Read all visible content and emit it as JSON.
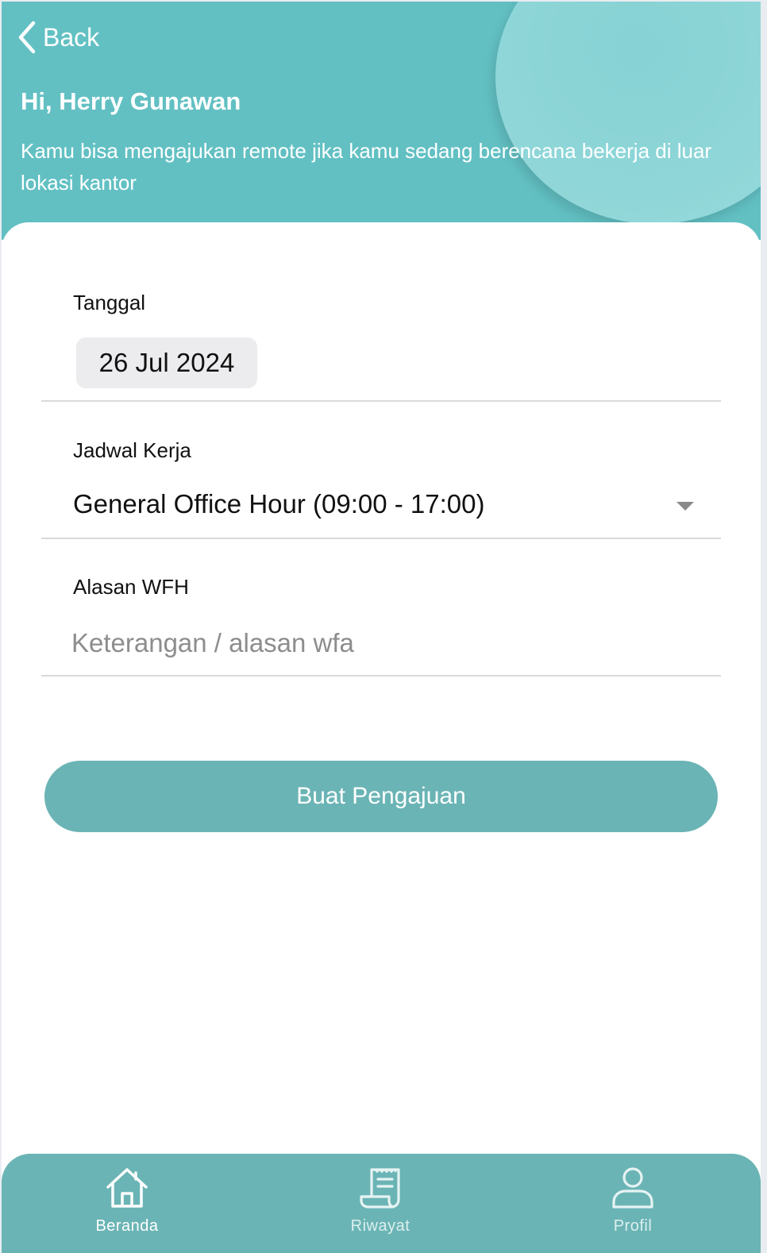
{
  "header": {
    "back_label": "Back",
    "greeting": "Hi, Herry Gunawan",
    "subtitle": "Kamu bisa mengajukan remote jika kamu sedang berencana bekerja di luar lokasi kantor"
  },
  "form": {
    "date": {
      "label": "Tanggal",
      "value": "26 Jul 2024"
    },
    "schedule": {
      "label": "Jadwal Kerja",
      "value": "General Office Hour (09:00 - 17:00)"
    },
    "reason": {
      "label": "Alasan WFH",
      "value": "",
      "placeholder": "Keterangan / alasan wfa"
    },
    "submit_label": "Buat Pengajuan"
  },
  "tabbar": {
    "items": [
      {
        "label": "Beranda",
        "icon": "home-icon",
        "active": true
      },
      {
        "label": "Riwayat",
        "icon": "receipt-icon",
        "active": false
      },
      {
        "label": "Profil",
        "icon": "user-icon",
        "active": false
      }
    ]
  },
  "colors": {
    "header_bg": "#62c0c3",
    "accent": "#6bb4b5",
    "text": "#111111",
    "placeholder": "#8d8d8d"
  }
}
